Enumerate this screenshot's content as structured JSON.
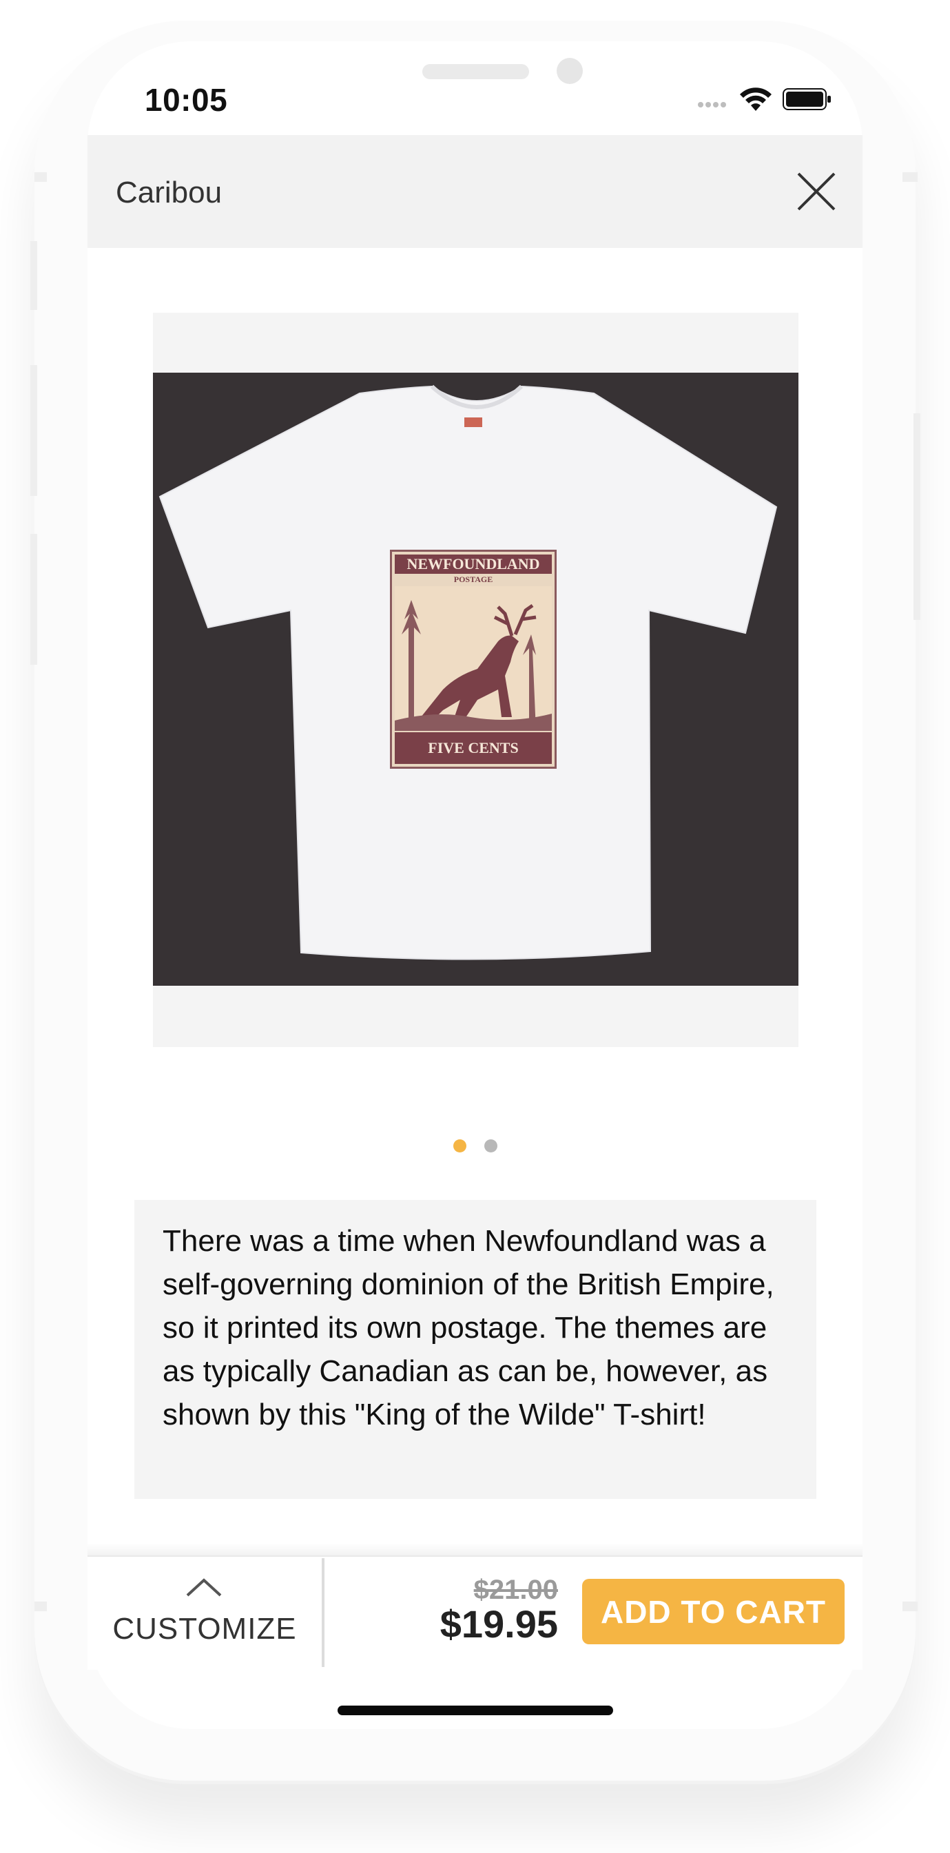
{
  "status_bar": {
    "time": "10:05",
    "icons": [
      "signal-icon",
      "wifi-icon",
      "battery-icon"
    ]
  },
  "header": {
    "title": "Caribou",
    "close_icon": "close-icon"
  },
  "product": {
    "image_alt": "White T-shirt with Newfoundland Postage caribou stamp",
    "stamp": {
      "top_text": "NEWFOUNDLAND",
      "sub_text": "POSTAGE",
      "bottom_text": "FIVE CENTS",
      "denomination": "5"
    },
    "carousel": {
      "count": 2,
      "active_index": 0
    },
    "description": "There was a time when Newfoundland was a self-governing dominion of the British Empire, so it printed its own postage. The themes are as typically Canadian as can be, however, as shown by this \"King of the Wilde\" T-shirt!"
  },
  "action_bar": {
    "customize_label": "CUSTOMIZE",
    "old_price": "$21.00",
    "price": "$19.95",
    "add_to_cart_label": "ADD TO CART"
  },
  "colors": {
    "accent": "#f5b544",
    "header_bg": "#f2f2f2",
    "image_bg": "#373234"
  }
}
